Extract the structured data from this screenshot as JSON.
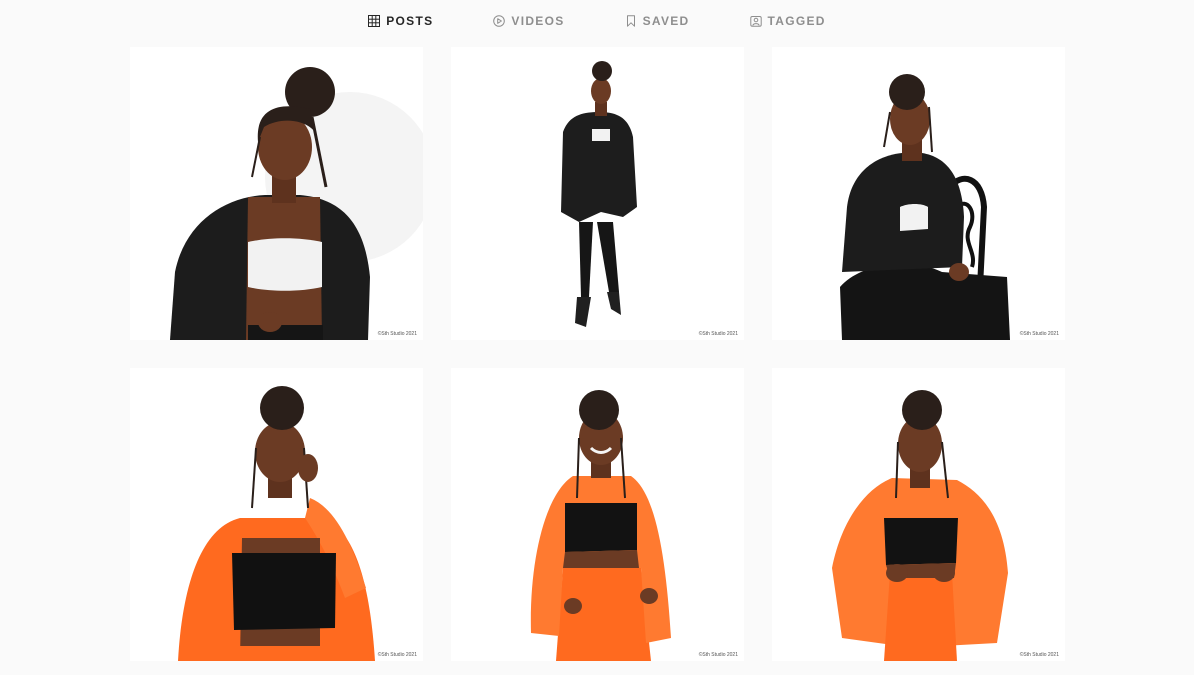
{
  "tabs": [
    {
      "label": "POSTS",
      "icon": "grid-icon",
      "active": true
    },
    {
      "label": "VIDEOS",
      "icon": "play-icon",
      "active": false
    },
    {
      "label": "SAVED",
      "icon": "bookmark-icon",
      "active": false
    },
    {
      "label": "TAGGED",
      "icon": "tagged-icon",
      "active": false
    }
  ],
  "colors": {
    "background": "#fafafa",
    "active_tab": "#262626",
    "inactive_tab": "#8e8e8e",
    "blazer_black": "#1a1a1a",
    "blazer_orange": "#ff6a1f",
    "skin": "#6b3b24"
  },
  "posts": [
    {
      "alt": "Woman in black blazer and white crop top, close portrait",
      "outfit": "black",
      "watermark": "©Sth Studio 2021"
    },
    {
      "alt": "Woman in black blazer and black trousers, full length standing",
      "outfit": "black",
      "watermark": "©Sth Studio 2021"
    },
    {
      "alt": "Woman in black blazer seated on ornate black chair",
      "outfit": "black",
      "watermark": "©Sth Studio 2021"
    },
    {
      "alt": "Woman in orange suit, hand raised to face",
      "outfit": "orange",
      "watermark": "©Sth Studio 2021"
    },
    {
      "alt": "Woman in orange suit smiling, hands on hips",
      "outfit": "orange",
      "watermark": "©Sth Studio 2021"
    },
    {
      "alt": "Woman in orange suit, hands on waist",
      "outfit": "orange",
      "watermark": "©Sth Studio 2021"
    }
  ]
}
